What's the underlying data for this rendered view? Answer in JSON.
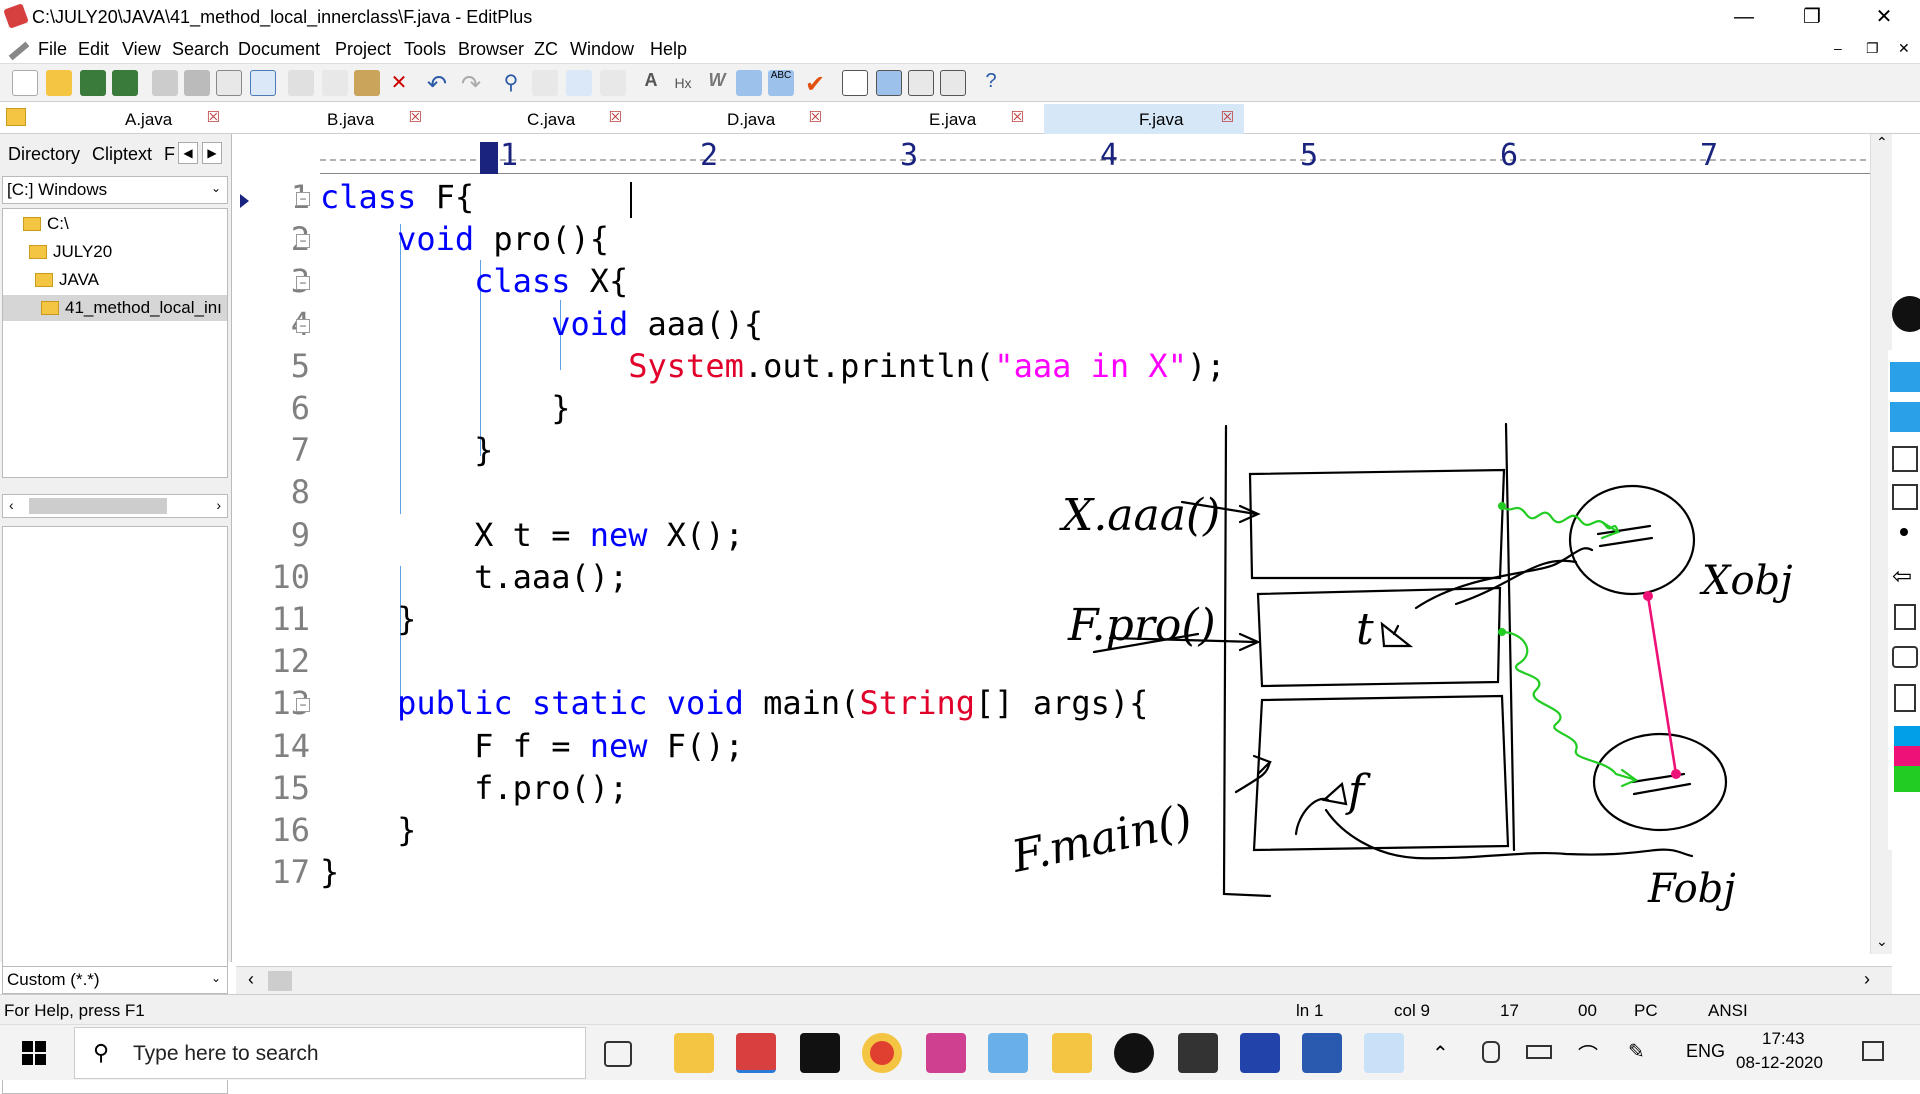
{
  "window": {
    "title": "C:\\JULY20\\JAVA\\41_method_local_innerclass\\F.java - EditPlus"
  },
  "menu": [
    "File",
    "Edit",
    "View",
    "Search",
    "Document",
    "Project",
    "Tools",
    "Browser",
    "ZC",
    "Window",
    "Help"
  ],
  "tabs": [
    {
      "label": "A.java",
      "active": false
    },
    {
      "label": "B.java",
      "active": false
    },
    {
      "label": "C.java",
      "active": false
    },
    {
      "label": "D.java",
      "active": false
    },
    {
      "label": "E.java",
      "active": false
    },
    {
      "label": "F.java",
      "active": true
    }
  ],
  "side": {
    "tab_directory": "Directory",
    "tab_cliptext": "Cliptext",
    "tab_more": "F",
    "drive": "[C:] Windows",
    "tree": [
      "C:\\",
      "JULY20",
      "JAVA",
      "41_method_local_inı"
    ],
    "filter": "Custom (*.*)"
  },
  "ruler": [
    "1",
    "2",
    "3",
    "4",
    "5",
    "6",
    "7"
  ],
  "code": {
    "line_numbers": [
      "1",
      "2",
      "3",
      "4",
      "5",
      "6",
      "7",
      "8",
      "9",
      "10",
      "11",
      "12",
      "13",
      "14",
      "15",
      "16",
      "17"
    ],
    "lines": [
      {
        "indent": "",
        "kw": "class",
        "rest": " F{"
      },
      {
        "indent": "    ",
        "kw": "void",
        "rest": " pro(){"
      },
      {
        "indent": "        ",
        "kw": "class",
        "rest": " X{"
      },
      {
        "indent": "            ",
        "kw": "void",
        "rest": " aaa(){"
      },
      {
        "indent": "                ",
        "cls": "System",
        "rest": ".out.println(",
        "str": "\"aaa in X\"",
        "tail": ");"
      },
      {
        "indent": "            ",
        "rest": "}"
      },
      {
        "indent": "        ",
        "rest": "}"
      },
      {
        "indent": "",
        "rest": ""
      },
      {
        "indent": "        ",
        "pre": "X t = ",
        "kw": "new",
        "rest": " X();"
      },
      {
        "indent": "        ",
        "rest": "t.aaa();"
      },
      {
        "indent": "    ",
        "rest": "}"
      },
      {
        "indent": "",
        "rest": ""
      },
      {
        "indent": "    ",
        "kw": "public static void",
        "rest": " main(",
        "cls": "String",
        "tail": "[] args){"
      },
      {
        "indent": "        ",
        "pre": "F f = ",
        "kw": "new",
        "rest": " F();"
      },
      {
        "indent": "        ",
        "rest": "f.pro();"
      },
      {
        "indent": "    ",
        "rest": "}"
      },
      {
        "indent": "",
        "rest": "}"
      }
    ]
  },
  "annotations": {
    "x_aaa": "X.aaa()",
    "f_pro": "F.pro()",
    "f_main": "F.main()",
    "t_var": "t",
    "f_var": "f",
    "x_obj": "Xobj",
    "f_obj": "Fobj"
  },
  "status": {
    "help": "For Help, press F1",
    "ln": "ln 1",
    "col": "col 9",
    "lines": "17",
    "ovr": "00",
    "mode": "PC",
    "enc": "ANSI"
  },
  "taskbar": {
    "search_placeholder": "Type here to search",
    "lang": "ENG",
    "time": "17:43",
    "date": "08-12-2020"
  }
}
